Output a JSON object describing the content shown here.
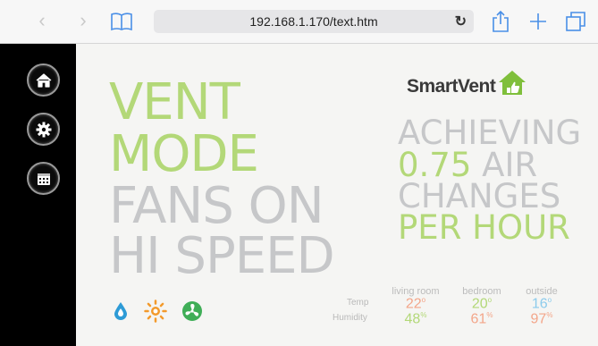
{
  "browser": {
    "url": "192.168.1.170/text.htm"
  },
  "sidebar": {
    "items": [
      {
        "name": "home-icon"
      },
      {
        "name": "gear-icon"
      },
      {
        "name": "calendar-icon"
      }
    ]
  },
  "main": {
    "mode_line1": "VENT",
    "mode_line2": "MODE",
    "fan_line1": "FANS ON",
    "fan_line2": "HI SPEED",
    "logo_text": "SmartVent",
    "achieving": "ACHIEVING",
    "rate_value": "0.75",
    "rate_unit": "AIR",
    "changes": "CHANGES",
    "per_hour": "PER HOUR"
  },
  "conditions": {
    "row_labels": {
      "temp": "Temp",
      "humidity": "Humidity"
    },
    "columns": [
      {
        "label": "living room",
        "temp": "22",
        "temp_unit": "o",
        "humidity": "48",
        "humidity_unit": "%"
      },
      {
        "label": "bedroom",
        "temp": "20",
        "temp_unit": "o",
        "humidity": "61",
        "humidity_unit": "%"
      },
      {
        "label": "outside",
        "temp": "16",
        "temp_unit": "o",
        "humidity": "97",
        "humidity_unit": "%"
      }
    ]
  },
  "colors": {
    "accent_green": "#b3d878",
    "grey_text": "#c6c7c9",
    "warm": "#f3a68a",
    "cool": "#8ccbec",
    "sidebar": "#000000"
  }
}
